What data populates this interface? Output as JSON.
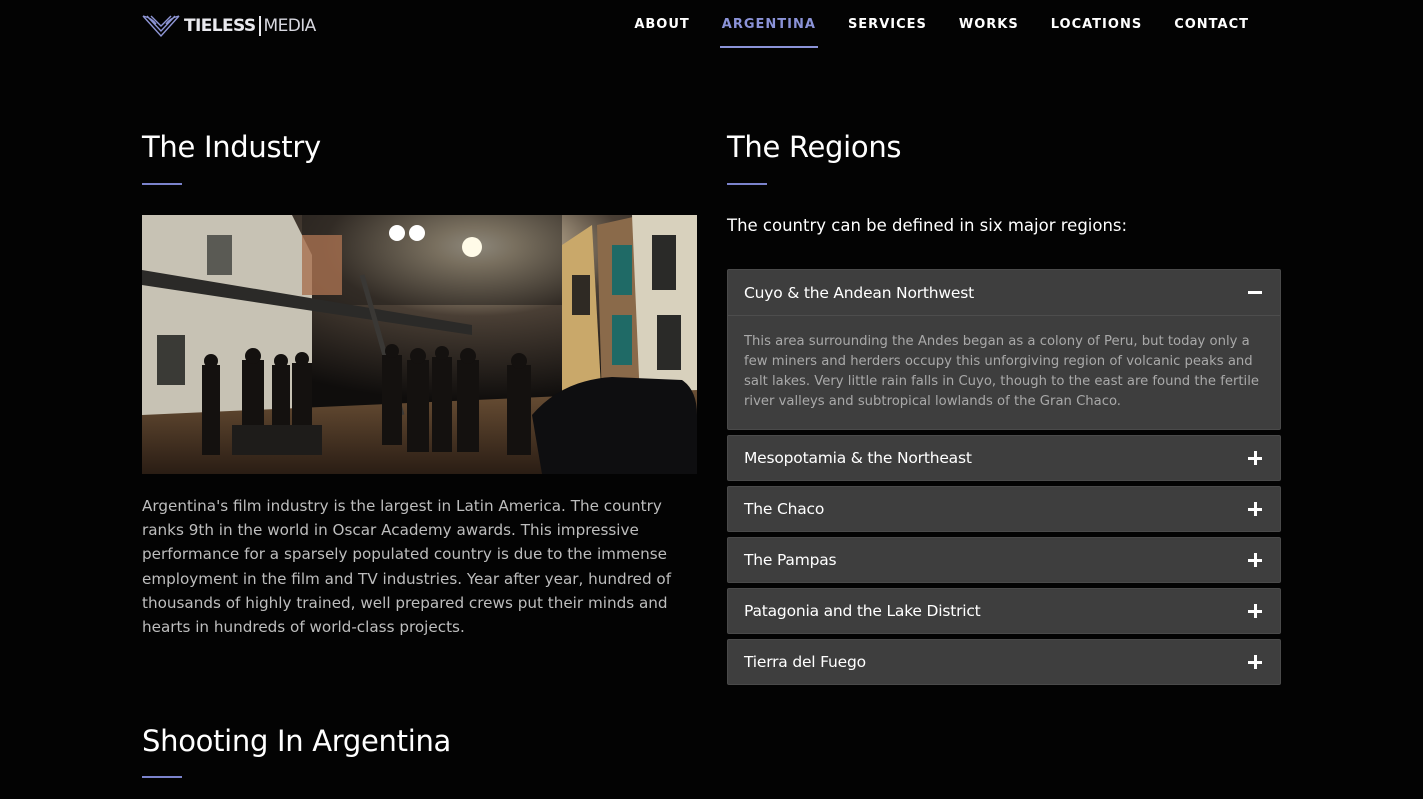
{
  "header": {
    "logo_bold": "TIELESS",
    "logo_light": "MEDIA",
    "nav": [
      {
        "label": "ABOUT",
        "active": false
      },
      {
        "label": "ARGENTINA",
        "active": true
      },
      {
        "label": "SERVICES",
        "active": false
      },
      {
        "label": "WORKS",
        "active": false
      },
      {
        "label": "LOCATIONS",
        "active": false
      },
      {
        "label": "CONTACT",
        "active": false
      }
    ]
  },
  "industry": {
    "title": "The Industry",
    "text": "Argentina's film industry is the largest in Latin America. The country ranks 9th in the world in Oscar Academy awards. This impressive performance for a sparsely populated country is due to the immense employment in the film and TV industries. Year after year, hundred of thousands of highly trained, well prepared crews put their minds and hearts in hundreds of world-class projects."
  },
  "regions": {
    "title": "The Regions",
    "intro": "The country can be defined in six major regions:",
    "items": [
      {
        "title": "Cuyo & the Andean Northwest",
        "expanded": true,
        "body": "This area surrounding the Andes began as a colony of Peru, but today only a few miners and herders occupy this unforgiving region of volcanic peaks and salt lakes. Very little rain falls in Cuyo, though to the east are found the fertile river valleys and subtropical lowlands of the Gran Chaco."
      },
      {
        "title": "Mesopotamia & the Northeast",
        "expanded": false
      },
      {
        "title": "The Chaco",
        "expanded": false
      },
      {
        "title": "The Pampas",
        "expanded": false
      },
      {
        "title": "Patagonia and the Lake District",
        "expanded": false
      },
      {
        "title": "Tierra del Fuego",
        "expanded": false
      }
    ]
  },
  "shooting": {
    "title": "Shooting In Argentina"
  },
  "colors": {
    "accent": "#8b93d8",
    "background": "#030303",
    "panel": "#3e3e3e"
  },
  "icons": {
    "collapse": "minus-icon",
    "expand": "plus-icon"
  }
}
